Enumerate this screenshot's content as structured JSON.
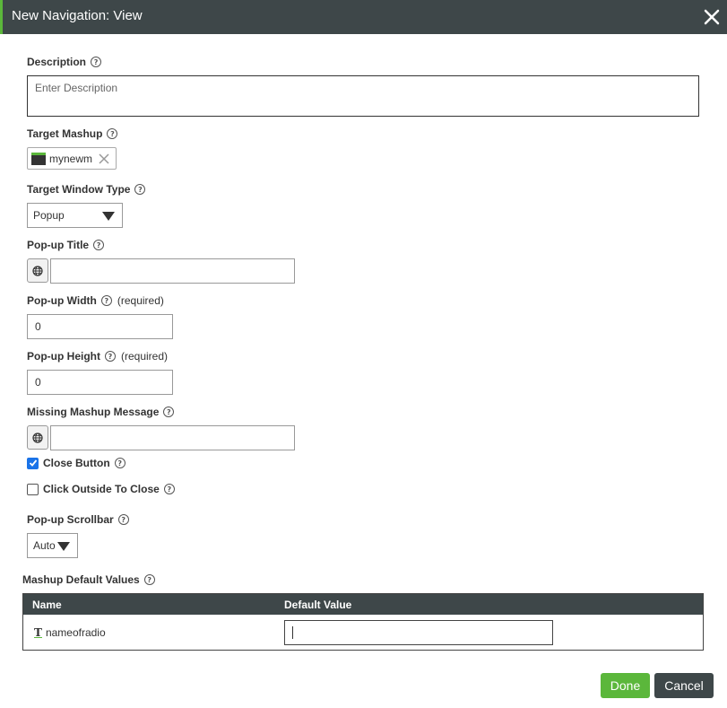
{
  "dialog": {
    "title": "New Navigation: View",
    "help_glyph": "?"
  },
  "description": {
    "label": "Description",
    "placeholder": "Enter Description"
  },
  "target_mashup": {
    "label": "Target Mashup",
    "chip_value": "mynewm"
  },
  "target_window_type": {
    "label": "Target Window Type",
    "selected": "Popup"
  },
  "popup_title": {
    "label": "Pop-up Title",
    "value": ""
  },
  "popup_width": {
    "label": "Pop-up Width",
    "required_text": "(required)",
    "value": "0"
  },
  "popup_height": {
    "label": "Pop-up Height",
    "required_text": "(required)",
    "value": "0"
  },
  "missing_mashup_message": {
    "label": "Missing Mashup Message",
    "value": ""
  },
  "close_button": {
    "label": "Close Button",
    "checked": true
  },
  "click_outside_to_close": {
    "label": "Click Outside To Close",
    "checked": false
  },
  "popup_scrollbar": {
    "label": "Pop-up Scrollbar",
    "selected": "Auto"
  },
  "default_values": {
    "label": "Mashup Default Values",
    "columns": [
      "Name",
      "Default Value"
    ],
    "rows": [
      {
        "name": "nameofradio",
        "default_value": ""
      }
    ]
  },
  "buttons": {
    "done": "Done",
    "cancel": "Cancel"
  },
  "colors": {
    "accent": "#5bb73b",
    "header_bg": "#3e4749",
    "checkbox": "#1a73e8"
  },
  "icons": {
    "close": "close-icon",
    "mashup": "mashup-icon",
    "globe": "globe-icon",
    "help": "help-icon",
    "text_param": "text-param-icon"
  }
}
